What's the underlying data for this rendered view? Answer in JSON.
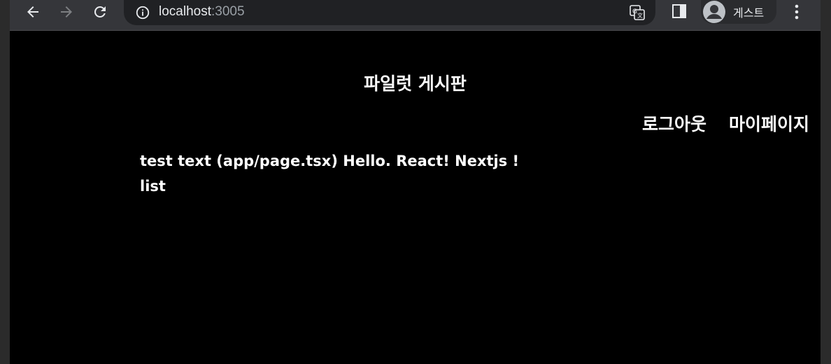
{
  "browser": {
    "url_host": "localhost",
    "url_port": ":3005",
    "profile_label": "게스트"
  },
  "page": {
    "title": "파일럿 게시판",
    "nav": {
      "logout": "로그아웃",
      "mypage": "마이페이지"
    },
    "test_text": "test text (app/page.tsx) Hello. React! Nextjs !",
    "list_link": "list"
  }
}
